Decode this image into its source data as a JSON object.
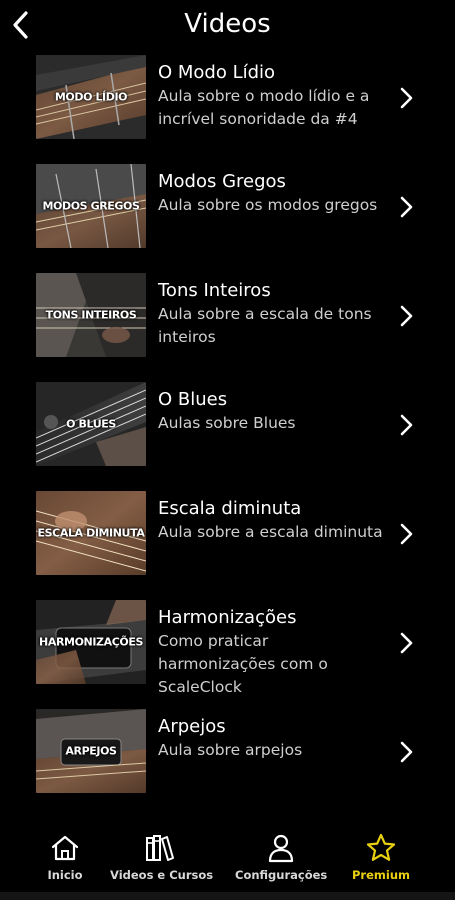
{
  "header": {
    "title": "Videos"
  },
  "videos": [
    {
      "thumb_label": "MODO LÍDIO",
      "title": "O Modo Lídio",
      "description": "Aula sobre o modo lídio e a incrível sonoridade da #4"
    },
    {
      "thumb_label": "MODOS GREGOS",
      "title": "Modos Gregos",
      "description": "Aula sobre os modos gregos"
    },
    {
      "thumb_label": "TONS INTEIROS",
      "title": "Tons Inteiros",
      "description": "Aula sobre a escala de tons inteiros"
    },
    {
      "thumb_label": "O BLUES",
      "title": "O Blues",
      "description": "Aulas sobre Blues"
    },
    {
      "thumb_label": "ESCALA DIMINUTA",
      "title": "Escala diminuta",
      "description": "Aula sobre a escala diminuta"
    },
    {
      "thumb_label": "HARMONIZAÇÕES",
      "title": "Harmonizações",
      "description": "Como praticar harmonizações com o ScaleClock"
    },
    {
      "thumb_label": "ARPEJOS",
      "title": "Arpejos",
      "description": "Aula sobre arpejos"
    }
  ],
  "tabbar": {
    "tabs": [
      {
        "label": "Inicio",
        "icon": "home-icon"
      },
      {
        "label": "Videos e Cursos",
        "icon": "books-icon"
      },
      {
        "label": "Configurações",
        "icon": "user-icon"
      },
      {
        "label": "Premium",
        "icon": "star-icon"
      }
    ],
    "active_color": "#e8d010"
  }
}
